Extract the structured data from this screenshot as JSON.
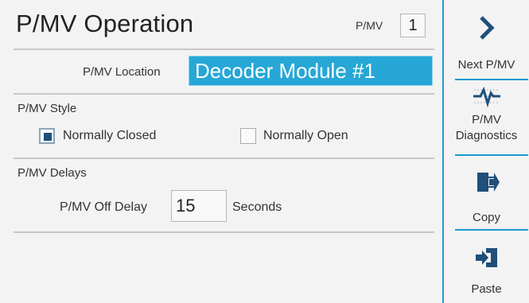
{
  "header": {
    "title": "P/MV Operation",
    "pmv_label": "P/MV",
    "pmv_number": "1"
  },
  "location": {
    "label": "P/MV Location",
    "value": "Decoder Module #1"
  },
  "style": {
    "section_label": "P/MV Style",
    "options": [
      {
        "label": "Normally Closed",
        "checked": true
      },
      {
        "label": "Normally Open",
        "checked": false
      }
    ]
  },
  "delays": {
    "section_label": "P/MV Delays",
    "off_delay_label": "P/MV Off Delay",
    "off_delay_value": "15",
    "unit": "Seconds"
  },
  "sidebar": {
    "items": [
      {
        "label": "Next P/MV",
        "icon": "chevron-right-icon"
      },
      {
        "label": "P/MV Diagnostics",
        "label_line1": "P/MV",
        "label_line2": "Diagnostics",
        "icon": "diagnostics-pulse-icon"
      },
      {
        "label": "Copy",
        "icon": "copy-icon"
      },
      {
        "label": "Paste",
        "icon": "paste-icon"
      }
    ]
  },
  "colors": {
    "accent": "#1a9ad3",
    "input_highlight": "#26a7d6",
    "icon_dark": "#1f4f7a"
  }
}
